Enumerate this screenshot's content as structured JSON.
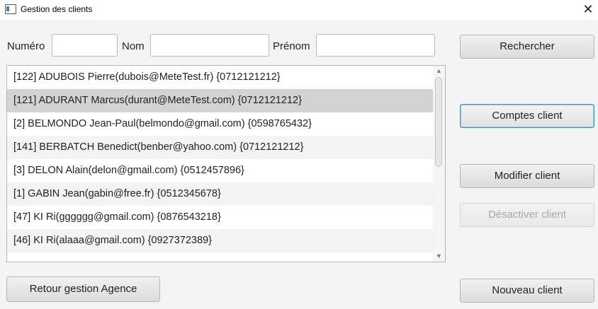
{
  "window": {
    "title": "Gestion des clients",
    "close_glyph": "✕"
  },
  "search": {
    "numero_label": "Numéro",
    "numero_value": "",
    "nom_label": "Nom",
    "nom_value": "",
    "prenom_label": "Prénom",
    "prenom_value": ""
  },
  "clients": [
    "[122]  ADUBOIS Pierre(dubois@MeteTest.fr)  {0712121212}",
    "[121]  ADURANT Marcus(durant@MeteTest.com)  {0712121212}",
    "[2]  BELMONDO Jean-Paul(belmondo@gmail.com)  {0598765432}",
    "[141]  BERBATCH Benedict(benber@yahoo.com)  {0712121212}",
    "[3]  DELON Alain(delon@gmail.com)  {0512457896}",
    "[1]  GABIN Jean(gabin@free.fr)  {0512345678}",
    "[47]  KI Ri(gggggg@gmail.com)  {0876543218}",
    "[46]  KI Ri(alaaa@gmail.com)  {0927372389}"
  ],
  "selected_index": 1,
  "buttons": {
    "search": "Rechercher",
    "accounts": "Comptes client",
    "modify": "Modifier client",
    "deactivate": "Désactiver client",
    "new_client": "Nouveau client",
    "back": "Retour gestion Agence"
  },
  "icons": {
    "scroll_up": "▲",
    "scroll_down": "▼"
  },
  "colors": {
    "selected_row": "#d3d3d3",
    "focus_border": "#3d9ad1"
  }
}
